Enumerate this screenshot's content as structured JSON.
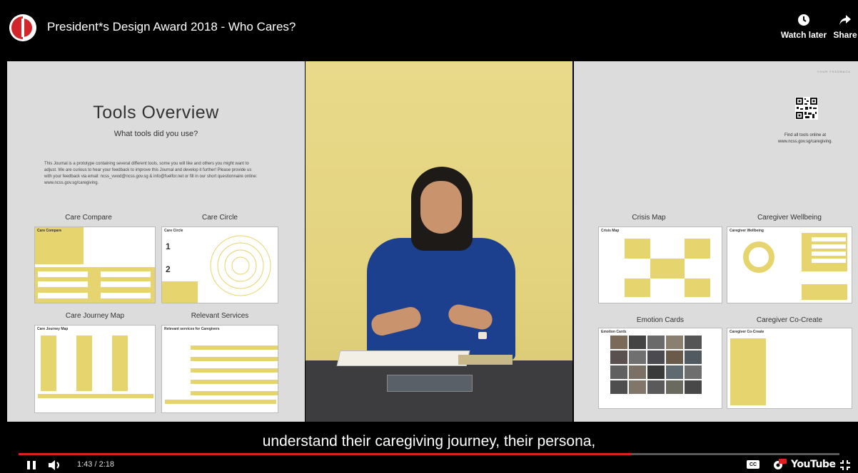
{
  "header": {
    "title": "President*s Design Award 2018 - Who Cares?",
    "watch_later_label": "Watch later",
    "share_label": "Share"
  },
  "left_slide": {
    "title": "Tools Overview",
    "subtitle": "What tools did you use?",
    "description": "This Journal is a prototype containing several different tools, some you will like and others you might want to adjust. We are curious to hear your feedback to improve this Journal and develop it further! Please provide us with your feedback via email: ncss_vwod@ncss.gov.sg & info@fuelfor.net or fill in our short questionnaire online: www.ncss.gov.sg/caregiving.",
    "sections": [
      {
        "label": "Care Compare",
        "card_title": "Care Compare"
      },
      {
        "label": "Care Circle",
        "card_title": "Care Circle"
      },
      {
        "label": "Care Journey Map",
        "card_title": "Care Journey Map"
      },
      {
        "label": "Relevant Services",
        "card_title": "Relevant services for Caregivers"
      }
    ]
  },
  "right_slide": {
    "feedback_tag": "YOUR FEEDBACK",
    "find_tools": "Find all tools online at www.ncss.gov.sg/caregiving.",
    "sections": [
      {
        "label": "Crisis Map",
        "card_title": "Crisis Map"
      },
      {
        "label": "Caregiver Wellbeing",
        "card_title": "Caregiver Wellbeing"
      },
      {
        "label": "Emotion Cards",
        "card_title": "Emotion Cards"
      },
      {
        "label": "Caregiver Co-Create",
        "card_title": "Caregiver Co-Create"
      }
    ]
  },
  "player": {
    "caption": "understand their caregiving journey, their persona,",
    "time": "1:43 / 2:18",
    "progress": 0.7464,
    "cc_label": "CC",
    "logo_text": "YouTube",
    "accent_color": "#e01f1f"
  }
}
